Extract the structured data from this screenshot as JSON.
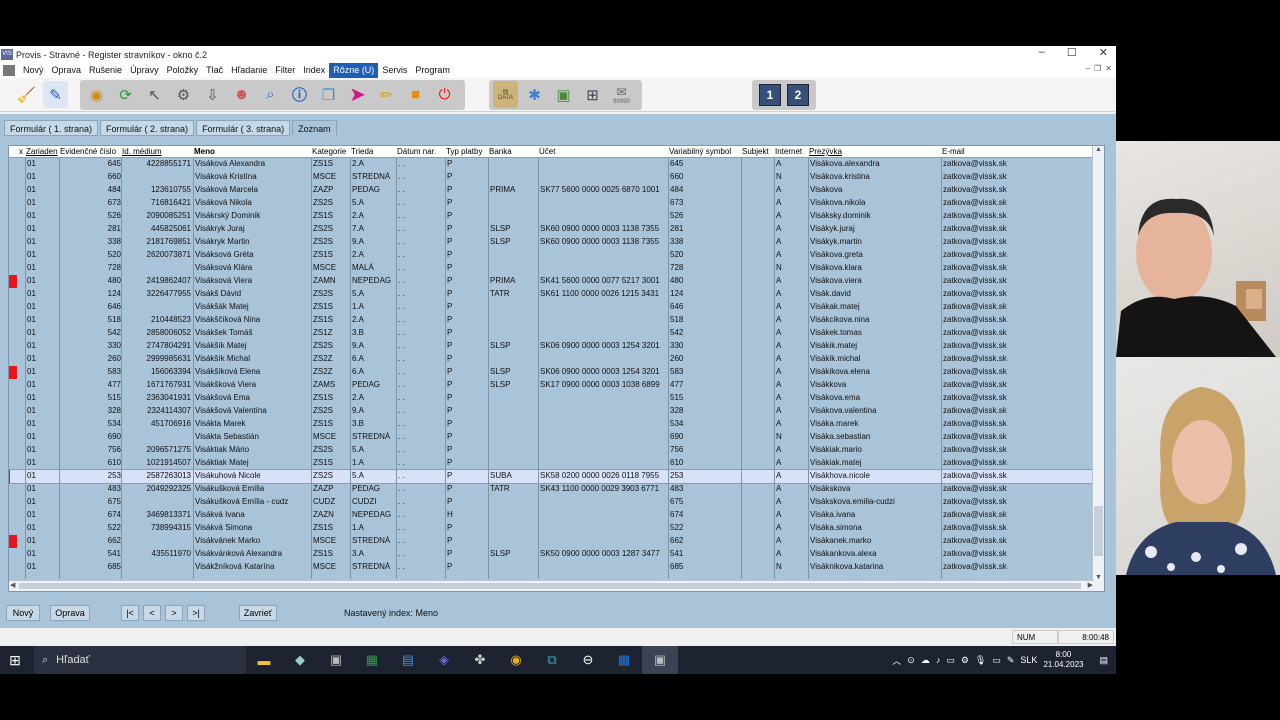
{
  "window": {
    "title": "Provis - Stravné - Register stravníkov - okno č.2",
    "app_icon_text": "VIS"
  },
  "menu": [
    "Nový",
    "Oprava",
    "Rušenie",
    "Úpravy",
    "Položky",
    "Tlač",
    "Hľadanie",
    "Filter",
    "Index",
    "Rôzne (U)",
    "Servis",
    "Program"
  ],
  "menu_active_index": 9,
  "toolbar": {
    "data_label": "DATA",
    "counter_label": "99999",
    "page1": "1",
    "page2": "2"
  },
  "tabs": [
    "Formulár ( 1. strana)",
    "Formulár ( 2. strana)",
    "Formulár ( 3. strana)",
    "Zoznam"
  ],
  "columns": [
    "x",
    "Zariaden",
    "Evidenčné číslo",
    "Id. médium",
    "Meno",
    "Kategorie",
    "Trieda",
    "Dátum nar.",
    "Typ platby",
    "Banka",
    "Účet",
    "Variabilný symbol",
    "Subjekt",
    "Internet",
    "Prezývka",
    "E-mail"
  ],
  "rows": [
    {
      "zar": "01",
      "ev": "645",
      "id": "4228855171",
      "meno": "Visáková Alexandra",
      "kat": "ZS1S",
      "tr": "2.A",
      "dat": ". .",
      "typ": "P",
      "banka": "",
      "ucet": "",
      "vs": "645",
      "subj": "",
      "inet": "A",
      "prez": "Visákova.alexandra",
      "email": "zatkova@vissk.sk",
      "red": false,
      "sel": false
    },
    {
      "zar": "01",
      "ev": "660",
      "id": "",
      "meno": "Visáková Kristína",
      "kat": "MSCE",
      "tr": "STREDNÁ",
      "dat": ". .",
      "typ": "P",
      "banka": "",
      "ucet": "",
      "vs": "660",
      "subj": "",
      "inet": "N",
      "prez": "Visákova.kristina",
      "email": "zatkova@vissk.sk",
      "red": false,
      "sel": false
    },
    {
      "zar": "01",
      "ev": "484",
      "id": "123610755",
      "meno": "Visáková Marcela",
      "kat": "ZAZP",
      "tr": "PEDAG",
      "dat": ". .",
      "typ": "P",
      "banka": "PRIMA",
      "ucet": "SK77 5600 0000 0025 6870 1001",
      "vs": "484",
      "subj": "",
      "inet": "A",
      "prez": "Visákova",
      "email": "zatkova@vissk.sk",
      "red": false,
      "sel": false
    },
    {
      "zar": "01",
      "ev": "673",
      "id": "716816421",
      "meno": "Visáková Nikola",
      "kat": "ZS2S",
      "tr": "5.A",
      "dat": ". .",
      "typ": "P",
      "banka": "",
      "ucet": "",
      "vs": "673",
      "subj": "",
      "inet": "A",
      "prez": "Visákova.nikola",
      "email": "zatkova@vissk.sk",
      "red": false,
      "sel": false
    },
    {
      "zar": "01",
      "ev": "526",
      "id": "2090085251",
      "meno": "Visákrský Dominik",
      "kat": "ZS1S",
      "tr": "2.A",
      "dat": ". .",
      "typ": "P",
      "banka": "",
      "ucet": "",
      "vs": "526",
      "subj": "",
      "inet": "A",
      "prez": "Visáksky.dominik",
      "email": "zatkova@vissk.sk",
      "red": false,
      "sel": false
    },
    {
      "zar": "01",
      "ev": "281",
      "id": "445825061",
      "meno": "Visákryk Juraj",
      "kat": "ZS2S",
      "tr": "7.A",
      "dat": ". .",
      "typ": "P",
      "banka": "SLSP",
      "ucet": "SK60 0900 0000 0003 1138 7355",
      "vs": "281",
      "subj": "",
      "inet": "A",
      "prez": "Visákyk.juraj",
      "email": "zatkova@vissk.sk",
      "red": false,
      "sel": false
    },
    {
      "zar": "01",
      "ev": "338",
      "id": "2181769851",
      "meno": "Visákryk Martin",
      "kat": "ZS2S",
      "tr": "9.A",
      "dat": ". .",
      "typ": "P",
      "banka": "SLSP",
      "ucet": "SK60 0900 0000 0003 1138 7355",
      "vs": "338",
      "subj": "",
      "inet": "A",
      "prez": "Visákyk.martin",
      "email": "zatkova@vissk.sk",
      "red": false,
      "sel": false
    },
    {
      "zar": "01",
      "ev": "520",
      "id": "2620073871",
      "meno": "Visáksová Gréta",
      "kat": "ZS1S",
      "tr": "2.A",
      "dat": ". .",
      "typ": "P",
      "banka": "",
      "ucet": "",
      "vs": "520",
      "subj": "",
      "inet": "A",
      "prez": "Visákova.greta",
      "email": "zatkova@vissk.sk",
      "red": false,
      "sel": false
    },
    {
      "zar": "01",
      "ev": "728",
      "id": "",
      "meno": "Visáksová Klára",
      "kat": "MSCE",
      "tr": "MALÁ",
      "dat": ". .",
      "typ": "P",
      "banka": "",
      "ucet": "",
      "vs": "728",
      "subj": "",
      "inet": "N",
      "prez": "Visákova.klara",
      "email": "zatkova@vissk.sk",
      "red": false,
      "sel": false
    },
    {
      "zar": "01",
      "ev": "480",
      "id": "2419862407",
      "meno": "Visáksová Viera",
      "kat": "ZAMN",
      "tr": "NEPEDAG",
      "dat": ". .",
      "typ": "P",
      "banka": "PRIMA",
      "ucet": "SK41 5600 0000 0077 5217 3001",
      "vs": "480",
      "subj": "",
      "inet": "A",
      "prez": "Visákova.viera",
      "email": "zatkova@vissk.sk",
      "red": true,
      "sel": false
    },
    {
      "zar": "01",
      "ev": "124",
      "id": "3226477955",
      "meno": "Visákš Dávid",
      "kat": "ZS2S",
      "tr": "5.A",
      "dat": ". .",
      "typ": "P",
      "banka": "TATR",
      "ucet": "SK61 1100 0000 0026 1215 3431",
      "vs": "124",
      "subj": "",
      "inet": "A",
      "prez": "Visák.david",
      "email": "zatkova@vissk.sk",
      "red": false,
      "sel": false
    },
    {
      "zar": "01",
      "ev": "646",
      "id": "",
      "meno": "Visákšák Matej",
      "kat": "ZS1S",
      "tr": "1.A",
      "dat": ". .",
      "typ": "P",
      "banka": "",
      "ucet": "",
      "vs": "646",
      "subj": "",
      "inet": "A",
      "prez": "Visákak.matej",
      "email": "zatkova@vissk.sk",
      "red": false,
      "sel": false
    },
    {
      "zar": "01",
      "ev": "518",
      "id": "210448523",
      "meno": "Visákščíková Nina",
      "kat": "ZS1S",
      "tr": "2.A",
      "dat": ". .",
      "typ": "P",
      "banka": "",
      "ucet": "",
      "vs": "518",
      "subj": "",
      "inet": "A",
      "prez": "Visákcikova.nina",
      "email": "zatkova@vissk.sk",
      "red": false,
      "sel": false
    },
    {
      "zar": "01",
      "ev": "542",
      "id": "2858006052",
      "meno": "Visákšek Tomáš",
      "kat": "ZS1Z",
      "tr": "3.B",
      "dat": ". .",
      "typ": "P",
      "banka": "",
      "ucet": "",
      "vs": "542",
      "subj": "",
      "inet": "A",
      "prez": "Visákek.tomas",
      "email": "zatkova@vissk.sk",
      "red": false,
      "sel": false
    },
    {
      "zar": "01",
      "ev": "330",
      "id": "2747804291",
      "meno": "Visákšík Matej",
      "kat": "ZS2S",
      "tr": "9.A",
      "dat": ". .",
      "typ": "P",
      "banka": "SLSP",
      "ucet": "SK06 0900 0000 0003 1254 3201",
      "vs": "330",
      "subj": "",
      "inet": "A",
      "prez": "Visákik.matej",
      "email": "zatkova@vissk.sk",
      "red": false,
      "sel": false
    },
    {
      "zar": "01",
      "ev": "260",
      "id": "2999985631",
      "meno": "Visákšík Michal",
      "kat": "ZS2Z",
      "tr": "6.A",
      "dat": ". .",
      "typ": "P",
      "banka": "",
      "ucet": "",
      "vs": "260",
      "subj": "",
      "inet": "A",
      "prez": "Visákik.michal",
      "email": "zatkova@vissk.sk",
      "red": false,
      "sel": false
    },
    {
      "zar": "01",
      "ev": "583",
      "id": "156063394",
      "meno": "Visákšíková Elena",
      "kat": "ZS2Z",
      "tr": "6.A",
      "dat": ". .",
      "typ": "P",
      "banka": "SLSP",
      "ucet": "SK06 0900 0000 0003 1254 3201",
      "vs": "583",
      "subj": "",
      "inet": "A",
      "prez": "Visákikova.elena",
      "email": "zatkova@vissk.sk",
      "red": true,
      "sel": false
    },
    {
      "zar": "01",
      "ev": "477",
      "id": "1671767931",
      "meno": "Visákšková Viera",
      "kat": "ZAMS",
      "tr": "PEDAG",
      "dat": ". .",
      "typ": "P",
      "banka": "SLSP",
      "ucet": "SK17 0900 0000 0003 1038 6899",
      "vs": "477",
      "subj": "",
      "inet": "A",
      "prez": "Visákkova",
      "email": "zatkova@vissk.sk",
      "red": false,
      "sel": false
    },
    {
      "zar": "01",
      "ev": "515",
      "id": "2363041931",
      "meno": "Visákšová Ema",
      "kat": "ZS1S",
      "tr": "2.A",
      "dat": ". .",
      "typ": "P",
      "banka": "",
      "ucet": "",
      "vs": "515",
      "subj": "",
      "inet": "A",
      "prez": "Visákova.ema",
      "email": "zatkova@vissk.sk",
      "red": false,
      "sel": false
    },
    {
      "zar": "01",
      "ev": "328",
      "id": "2324114307",
      "meno": "Visákšová Valentína",
      "kat": "ZS2S",
      "tr": "9.A",
      "dat": ". .",
      "typ": "P",
      "banka": "",
      "ucet": "",
      "vs": "328",
      "subj": "",
      "inet": "A",
      "prez": "Visákova.valentina",
      "email": "zatkova@vissk.sk",
      "red": false,
      "sel": false
    },
    {
      "zar": "01",
      "ev": "534",
      "id": "451706916",
      "meno": "Visákta Marek",
      "kat": "ZS1S",
      "tr": "3.B",
      "dat": ". .",
      "typ": "P",
      "banka": "",
      "ucet": "",
      "vs": "534",
      "subj": "",
      "inet": "A",
      "prez": "Visáka.marek",
      "email": "zatkova@vissk.sk",
      "red": false,
      "sel": false
    },
    {
      "zar": "01",
      "ev": "690",
      "id": "",
      "meno": "Visákta Sebastián",
      "kat": "MSCE",
      "tr": "STREDNÁ",
      "dat": ". .",
      "typ": "P",
      "banka": "",
      "ucet": "",
      "vs": "690",
      "subj": "",
      "inet": "N",
      "prez": "Visáka.sebastian",
      "email": "zatkova@vissk.sk",
      "red": false,
      "sel": false
    },
    {
      "zar": "01",
      "ev": "756",
      "id": "2096571275",
      "meno": "Visáktiak Mário",
      "kat": "ZS2S",
      "tr": "5.A",
      "dat": ". .",
      "typ": "P",
      "banka": "",
      "ucet": "",
      "vs": "756",
      "subj": "",
      "inet": "A",
      "prez": "Visákiak.mario",
      "email": "zatkova@vissk.sk",
      "red": false,
      "sel": false
    },
    {
      "zar": "01",
      "ev": "610",
      "id": "1021914507",
      "meno": "Visáktiak Matej",
      "kat": "ZS1S",
      "tr": "1.A",
      "dat": ". .",
      "typ": "P",
      "banka": "",
      "ucet": "",
      "vs": "610",
      "subj": "",
      "inet": "A",
      "prez": "Visákiak.matej",
      "email": "zatkova@vissk.sk",
      "red": false,
      "sel": false
    },
    {
      "zar": "01",
      "ev": "253",
      "id": "2587263013",
      "meno": "Visákuhová Nicole",
      "kat": "ZS2S",
      "tr": "5.A",
      "dat": ". .",
      "typ": "P",
      "banka": "SUBA",
      "ucet": "SK58 0200 0000 0026 0118 7955",
      "vs": "253",
      "subj": "",
      "inet": "A",
      "prez": "Visákhova.nicole",
      "email": "zatkova@vissk.sk",
      "red": true,
      "sel": true
    },
    {
      "zar": "01",
      "ev": "483",
      "id": "2049292325",
      "meno": "Visákušková Emília",
      "kat": "ZAZP",
      "tr": "PEDAG",
      "dat": ". .",
      "typ": "P",
      "banka": "TATR",
      "ucet": "SK43 1100 0000 0029 3903 6771",
      "vs": "483",
      "subj": "",
      "inet": "A",
      "prez": "Visákskova",
      "email": "zatkova@vissk.sk",
      "red": false,
      "sel": false
    },
    {
      "zar": "01",
      "ev": "675",
      "id": "",
      "meno": "Visákušková Emília - cudz",
      "kat": "CUDZ",
      "tr": "CUDZI",
      "dat": ". .",
      "typ": "P",
      "banka": "",
      "ucet": "",
      "vs": "675",
      "subj": "",
      "inet": "A",
      "prez": "Visákskova.emilia-cudzi",
      "email": "zatkova@vissk.sk",
      "red": false,
      "sel": false
    },
    {
      "zar": "01",
      "ev": "674",
      "id": "3469813371",
      "meno": "Visákvá Ivana",
      "kat": "ZAZN",
      "tr": "NEPEDAG",
      "dat": ". .",
      "typ": "H",
      "banka": "",
      "ucet": "",
      "vs": "674",
      "subj": "",
      "inet": "A",
      "prez": "Visáka.ivana",
      "email": "zatkova@vissk.sk",
      "red": false,
      "sel": false
    },
    {
      "zar": "01",
      "ev": "522",
      "id": "738994315",
      "meno": "Visákvá Simona",
      "kat": "ZS1S",
      "tr": "1.A",
      "dat": ". .",
      "typ": "P",
      "banka": "",
      "ucet": "",
      "vs": "522",
      "subj": "",
      "inet": "A",
      "prez": "Visáka.simona",
      "email": "zatkova@vissk.sk",
      "red": false,
      "sel": false
    },
    {
      "zar": "01",
      "ev": "662",
      "id": "",
      "meno": "Visákvánek Marko",
      "kat": "MSCE",
      "tr": "STREDNÁ",
      "dat": ". .",
      "typ": "P",
      "banka": "",
      "ucet": "",
      "vs": "662",
      "subj": "",
      "inet": "A",
      "prez": "Visákanek.marko",
      "email": "zatkova@vissk.sk",
      "red": true,
      "sel": false
    },
    {
      "zar": "01",
      "ev": "541",
      "id": "435511970",
      "meno": "Visákvánková Alexandra",
      "kat": "ZS1S",
      "tr": "3.A",
      "dat": ". .",
      "typ": "P",
      "banka": "SLSP",
      "ucet": "SK50 0900 0000 0003 1287 3477",
      "vs": "541",
      "subj": "",
      "inet": "A",
      "prez": "Visákankova.alexa",
      "email": "zatkova@vissk.sk",
      "red": false,
      "sel": false
    },
    {
      "zar": "01",
      "ev": "685",
      "id": "",
      "meno": "Visákžníková Katarína",
      "kat": "MSCE",
      "tr": "STREDNÁ",
      "dat": ". .",
      "typ": "P",
      "banka": "",
      "ucet": "",
      "vs": "685",
      "subj": "",
      "inet": "N",
      "prez": "Visáknikova.katarina",
      "email": "zatkova@vissk.sk",
      "red": false,
      "sel": false
    }
  ],
  "bottom": {
    "new_label": "Nový",
    "edit_label": "Oprava",
    "first": "|<",
    "prev": "<",
    "next": ">",
    "last": ">|",
    "close_label": "Zavrieť",
    "status_text": "Nastavený index: Meno"
  },
  "statusbar": {
    "num": "NUM",
    "time": "8:00:48"
  },
  "taskbar": {
    "search_placeholder": "Hľadať",
    "lang": "SLK",
    "clock_time": "8:00",
    "clock_date": "21.04.2023"
  },
  "colors": {
    "grid_bg": "#a9c3d9",
    "red_marker": "#e8161c",
    "menu_active": "#1d5fb4",
    "selected_row": "#d7e1f7"
  }
}
